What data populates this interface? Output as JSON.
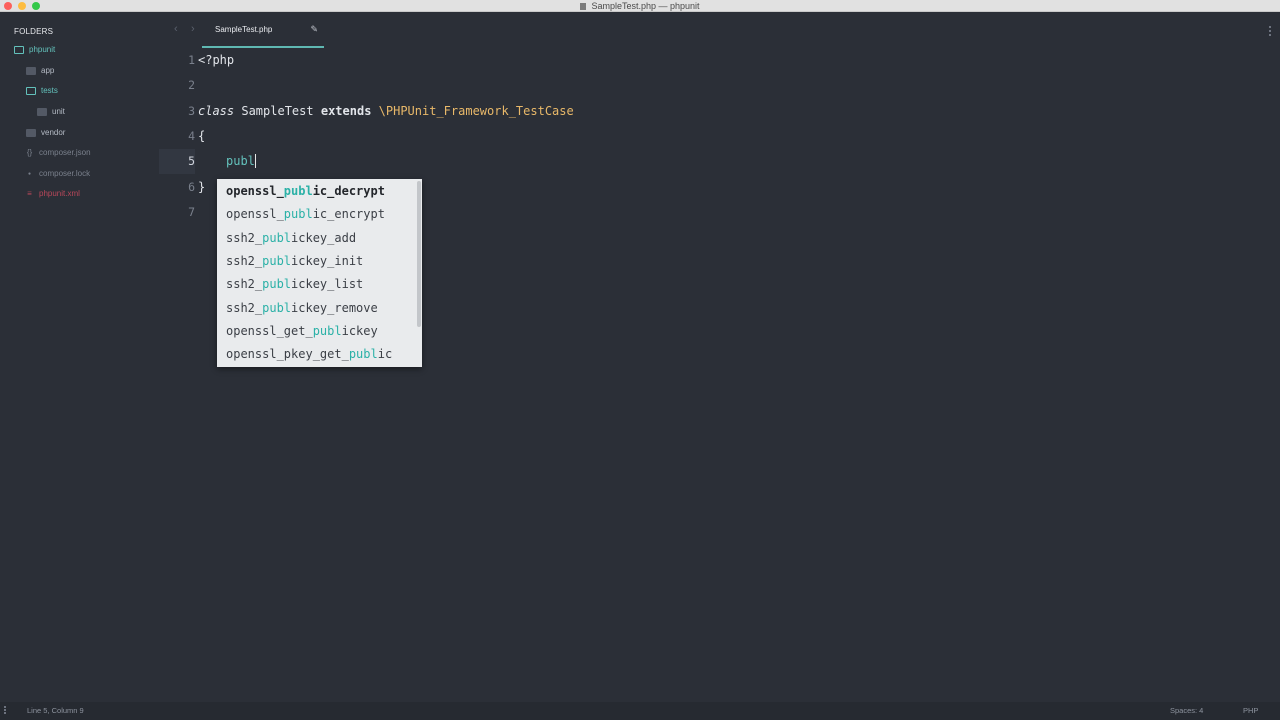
{
  "window": {
    "title": "SampleTest.php — phpunit"
  },
  "sidebar": {
    "header": "FOLDERS",
    "items": [
      {
        "label": "phpunit",
        "kind": "folder-open",
        "color": "#63c1bb"
      },
      {
        "label": "app",
        "kind": "folder",
        "color": "#b4bac4"
      },
      {
        "label": "tests",
        "kind": "folder-open",
        "color": "#63c1bb"
      },
      {
        "label": "unit",
        "kind": "folder",
        "color": "#b4bac4"
      },
      {
        "label": "vendor",
        "kind": "folder",
        "color": "#b4bac4"
      },
      {
        "label": "composer.json",
        "kind": "file",
        "icon": "{}",
        "color": "#7a808c"
      },
      {
        "label": "composer.lock",
        "kind": "file",
        "icon": "●",
        "color": "#7a808c"
      },
      {
        "label": "phpunit.xml",
        "kind": "file",
        "icon": "≡",
        "color": "#b8475a"
      }
    ]
  },
  "tabs": {
    "back_icon": "‹",
    "forward_icon": "›",
    "active": {
      "label": "SampleTest.php",
      "edit_icon": "✎"
    }
  },
  "editor": {
    "line_numbers": [
      "1",
      "2",
      "3",
      "4",
      "5",
      "6",
      "7"
    ],
    "line1": "<?php",
    "line3": {
      "class_kw": "class",
      "class_name": "SampleTest",
      "extends_kw": "extends",
      "parent": "\\PHPUnit_Framework_TestCase"
    },
    "line4": "{",
    "line5_typed": "publ",
    "line6": "}"
  },
  "autocomplete": {
    "items": [
      {
        "pre": "openssl_",
        "match": "publ",
        "post": "ic_decrypt",
        "selected": true
      },
      {
        "pre": "openssl_",
        "match": "publ",
        "post": "ic_encrypt",
        "selected": false
      },
      {
        "pre": "ssh2_",
        "match": "publ",
        "post": "ickey_add",
        "selected": false
      },
      {
        "pre": "ssh2_",
        "match": "publ",
        "post": "ickey_init",
        "selected": false
      },
      {
        "pre": "ssh2_",
        "match": "publ",
        "post": "ickey_list",
        "selected": false
      },
      {
        "pre": "ssh2_",
        "match": "publ",
        "post": "ickey_remove",
        "selected": false
      },
      {
        "pre": "openssl_get_",
        "match": "publ",
        "post": "ickey",
        "selected": false
      },
      {
        "pre": "openssl_pkey_get_",
        "match": "publ",
        "post": "ic",
        "selected": false
      }
    ]
  },
  "statusbar": {
    "position": "Line 5, Column 9",
    "spaces": "Spaces: 4",
    "syntax": "PHP"
  }
}
